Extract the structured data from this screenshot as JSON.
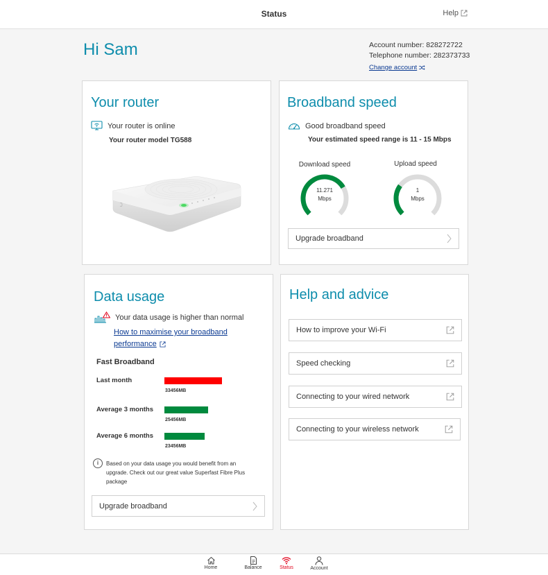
{
  "header": {
    "title": "Status",
    "help_label": "Help"
  },
  "greeting": "Hi Sam",
  "account": {
    "account_number": "Account number: 828272722",
    "telephone_number": "Telephone number: 282373733",
    "change_label": "Change account"
  },
  "router": {
    "title": "Your router",
    "status": "Your router is online",
    "model": "Your router model TG588"
  },
  "speed": {
    "title": "Broadband speed",
    "status": "Good broadband speed",
    "range": "Your estimated speed range is 11 - 15 Mbps",
    "download": {
      "label": "Download speed",
      "value": "11.271",
      "unit": "Mbps",
      "fill_fraction": 0.72
    },
    "upload": {
      "label": "Upload speed",
      "value": "1",
      "unit": "Mbps",
      "fill_fraction": 0.3
    },
    "upgrade_label": "Upgrade broadband"
  },
  "usage": {
    "title": "Data usage",
    "status": "Your data usage is higher than normal",
    "link_line1": "How to maximise your broadband",
    "link_line2": "performance",
    "plan": "Fast Broadband",
    "rows": [
      {
        "label": "Last month",
        "value_mb": 33456,
        "display": "33456MB",
        "color": "#ff0000"
      },
      {
        "label": "Average 3 months",
        "value_mb": 25456,
        "display": "25456MB",
        "color": "#008a3e"
      },
      {
        "label": "Average 6 months",
        "value_mb": 23456,
        "display": "23456MB",
        "color": "#008a3e"
      }
    ],
    "info_line1": "Based on your data usage you would benefit from an",
    "info_line2": "upgrade. Check out our great value Superfast Fibre Plus",
    "info_line3": "package",
    "upgrade_label": "Upgrade broadband"
  },
  "advice": {
    "title": "Help and advice",
    "items": [
      {
        "label": "How to improve your Wi-Fi"
      },
      {
        "label": "Speed checking"
      },
      {
        "label": "Connecting to your wired network"
      },
      {
        "label": "Connecting to your wireless network"
      }
    ]
  },
  "nav": {
    "home": "Home",
    "balance": "Balance",
    "status": "Status",
    "account": "Account"
  },
  "colors": {
    "brand": "#0e8dac",
    "active": "#e1001a",
    "gauge": "#008a3e",
    "link": "#0b3a92"
  }
}
